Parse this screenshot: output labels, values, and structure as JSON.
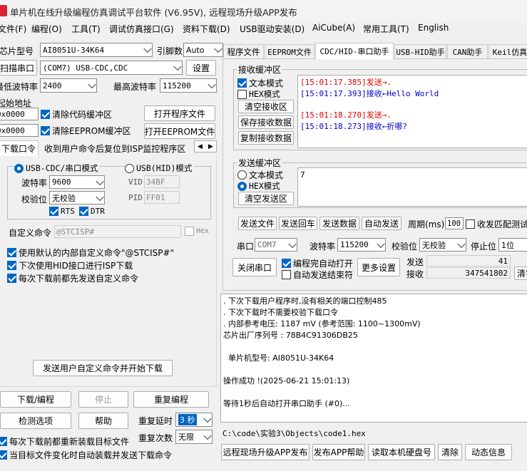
{
  "title_bar": {
    "title": "单片机在线升级编程仿真调试平台软件 (V6.95V), 远程现场升级APP发布"
  },
  "menu": [
    "文件(F)",
    "编程(O)",
    "工具(T)",
    "调试仿真接口(G)",
    "资料下载(D)",
    "USB驱动安装(D)",
    "AiCube(A)",
    "常用工具(T)",
    "English"
  ],
  "left": {
    "chip_label": "芯片型号",
    "chip_value": "AI8051U-34K64",
    "pin_label": "引脚数",
    "pin_value": "Auto",
    "scan_button": "扫描串口",
    "port_value": "(COM7) USB-CDC,CDC",
    "settings_button": "设置",
    "min_baud_label": "最低波特率",
    "min_baud_value": "2400",
    "max_baud_label": "最高波特率",
    "max_baud_value": "115200",
    "start_addr_label": "起始地址",
    "addr1": "0x0000",
    "clear_code_label": "清除代码缓冲区",
    "open_prog_button": "打开程序文件",
    "addr2": "0x0000",
    "clear_eeprom_label": "清除EEPROM缓冲区",
    "open_eeprom_button": "打开EEPROM文件",
    "tab_download": "下载口令",
    "tab_isp": "收到用户命令后复位到ISP监控程序区",
    "usb_cdc_label": "USB-CDC/串口模式",
    "usb_hid_label": "USB(HID)模式",
    "baud_label": "波特率",
    "baud_value": "9600",
    "parity_label": "校验位",
    "parity_value": "无校验",
    "vid_label": "VID",
    "vid_value": "34BF",
    "pid_label": "PID",
    "pid_value": "FF01",
    "rts_label": "RTS",
    "dtr_label": "DTR",
    "custom_cmd_label": "自定义命令",
    "custom_cmd_value": "@STCISP#",
    "hex_label": "Hex",
    "opt1": "使用默认的内部自定义命令\"@STCISP#\"",
    "opt2": "下次使用HID接口进行ISP下载",
    "opt3": "每次下载前都先发送自定义命令",
    "send_custom_button": "发送用户自定义命令并开始下载",
    "download_button": "下载/编程",
    "stop_button": "停止",
    "reprogram_button": "重复编程",
    "check_button": "检测选项",
    "help_button": "帮助",
    "repeat_delay_label": "重复延时",
    "repeat_delay_value": "3 秒",
    "reload_label": "每次下载前都重新装载目标文件",
    "repeat_count_label": "重复次数",
    "repeat_count_value": "无限",
    "auto_load_label": "当目标文件变化时自动装载并发送下载命令"
  },
  "right": {
    "tabs": [
      "程序文件",
      "EEPROM文件",
      "CDC/HID-串口助手",
      "USB-HID助手",
      "CAN助手",
      "Keil仿真"
    ],
    "rx_group": "接收缓冲区",
    "rx_text_mode": "文本模式",
    "rx_hex_mode": "HEX模式",
    "clear_rx_button": "清空接收区",
    "save_rx_button": "保存接收数据",
    "copy_rx_button": "复制接收数据",
    "rx_log": [
      {
        "time": "[15:01:17.385]",
        "dir": "发送→",
        "data": "."
      },
      {
        "time": "[15:01:17.393]",
        "dir": "接收←",
        "data": "Hello World"
      },
      {
        "time": "[15:01:18.270]",
        "dir": "发送→",
        "data": "."
      },
      {
        "time": "[15:01:18.273]",
        "dir": "接收←",
        "data": "折哪?"
      }
    ],
    "tx_group": "发送缓冲区",
    "tx_text_mode": "文本模式",
    "tx_hex_mode": "HEX模式",
    "clear_tx_button": "清空发送区",
    "tx_value": "7",
    "send_file_button": "发送文件",
    "send_enter_button": "发送回车",
    "send_data_button": "发送数据",
    "auto_send_button": "自动发送",
    "period_label": "周期(ms)",
    "period_value": "100",
    "match_label": "收发匹配测试",
    "port_label": "串口",
    "port_value": "COM7",
    "baud_label": "波特率",
    "baud_value": "115200",
    "parity_label": "校验位",
    "parity_value": "无校验",
    "stop_label": "停止位",
    "stop_value": "1位",
    "close_port_button": "关闭串口",
    "auto_open_label": "编程完自动打开",
    "auto_end_label": "自动发送结束符",
    "more_settings_button": "更多设置",
    "send_count_label": "发送",
    "send_count": "41",
    "recv_count_label": "接收",
    "recv_count": "347541802",
    "clear_count_button": "清零"
  },
  "output": {
    "lines": [
      ". 下次下载用户程序时,没有相关的端口控制485",
      ". 下次下载时不需要校验下载口令",
      ". 内部参考电压: 1187 mV (参考范围: 1100~1300mV)",
      "芯片出厂序列号 : 78B4C91306DB25",
      "",
      "  单片机型号: AI8051U-34K64",
      "",
      "操作成功 !(2025-06-21 15:01:13)",
      "",
      "等待1秒后自动打开串口助手 (#0)..."
    ],
    "path": "C:\\code\\实验3\\Objects\\code1.hex"
  },
  "bottom": {
    "publish_button": "远程现场升级APP发布",
    "help_button": "发布APP帮助",
    "read_disk_button": "读取本机硬盘号",
    "clear_button": "清除",
    "dynamic_button": "动态信息"
  },
  "colors": {
    "accent": "#0067c0",
    "send_red": "#e00000",
    "recv_blue": "#0000cc"
  }
}
